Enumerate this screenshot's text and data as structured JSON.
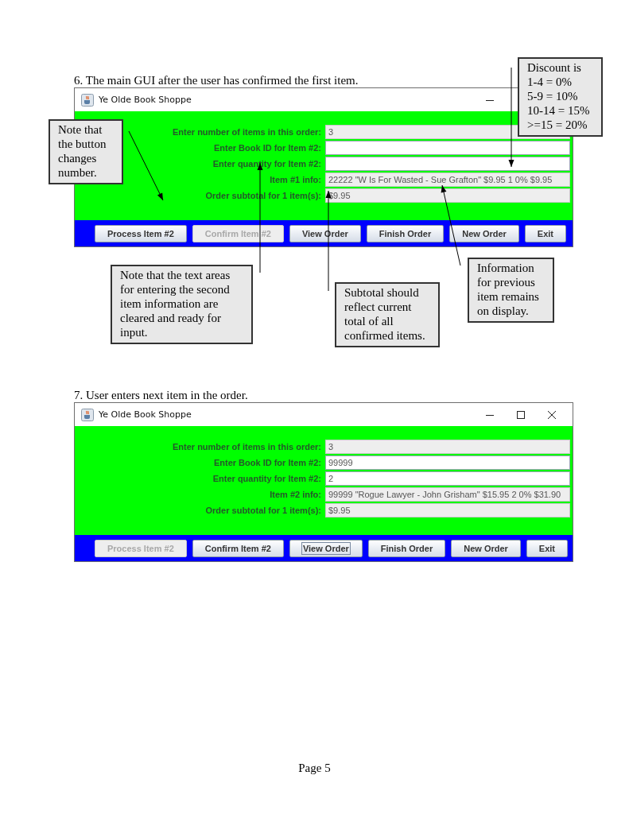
{
  "steps": [
    {
      "caption": "6. The main GUI after the user has confirmed the first item.",
      "window": {
        "title": "Ye Olde Book Shoppe",
        "controls": [
          {
            "kind": "minimize"
          }
        ],
        "rows": [
          {
            "label": "Enter number of items in this order:",
            "value": "3",
            "editable": false
          },
          {
            "label": "Enter Book ID for Item #2:",
            "value": "",
            "editable": true
          },
          {
            "label": "Enter quantity for Item #2:",
            "value": "",
            "editable": true
          },
          {
            "label": "Item #1 info:",
            "value": "22222 \"W Is For Wasted - Sue Grafton\" $9.95 1 0% $9.95",
            "editable": false
          },
          {
            "label": "Order subtotal for 1 item(s):",
            "value": "$9.95",
            "editable": false
          }
        ],
        "buttons": [
          {
            "label": "Process Item #2",
            "disabled": false,
            "focused": false
          },
          {
            "label": "Confirm Item #2",
            "disabled": true,
            "focused": false
          },
          {
            "label": "View Order",
            "disabled": false,
            "focused": false
          },
          {
            "label": "Finish Order",
            "disabled": false,
            "focused": false
          },
          {
            "label": "New Order",
            "disabled": false,
            "focused": false
          },
          {
            "label": "Exit",
            "disabled": false,
            "focused": false
          }
        ]
      }
    },
    {
      "caption": "7.  User enters next item in the order.",
      "window": {
        "title": "Ye Olde Book Shoppe",
        "controls": [
          {
            "kind": "minimize"
          },
          {
            "kind": "maximize"
          },
          {
            "kind": "close"
          }
        ],
        "rows": [
          {
            "label": "Enter number of items in this order:",
            "value": "3",
            "editable": false
          },
          {
            "label": "Enter Book ID for Item #2:",
            "value": "99999",
            "editable": true
          },
          {
            "label": "Enter quantity for Item #2:",
            "value": "2",
            "editable": true
          },
          {
            "label": "Item #2 info:",
            "value": "99999 \"Rogue Lawyer - John Grisham\" $15.95 2 0% $31.90",
            "editable": false
          },
          {
            "label": "Order subtotal for 1 item(s):",
            "value": "$9.95",
            "editable": false
          }
        ],
        "buttons": [
          {
            "label": "Process Item #2",
            "disabled": true,
            "focused": false
          },
          {
            "label": "Confirm Item #2",
            "disabled": false,
            "focused": false
          },
          {
            "label": "View Order",
            "disabled": false,
            "focused": true
          },
          {
            "label": "Finish Order",
            "disabled": false,
            "focused": false
          },
          {
            "label": "New Order",
            "disabled": false,
            "focused": false
          },
          {
            "label": "Exit",
            "disabled": false,
            "focused": false
          }
        ]
      }
    }
  ],
  "callouts": [
    {
      "lines": [
        "Note that",
        "the button",
        "changes",
        "number."
      ]
    },
    {
      "lines": [
        "Discount is",
        "1-4 = 0%",
        "5-9 = 10%",
        "10-14 = 15%",
        ">=15 = 20%"
      ]
    },
    {
      "lines": [
        "Note that the text areas",
        "for entering the second",
        "item information are",
        "cleared and ready for",
        "input."
      ]
    },
    {
      "lines": [
        "Subtotal should",
        "reflect current",
        "total of all",
        "confirmed items."
      ]
    },
    {
      "lines": [
        "Information",
        "for previous",
        "item remains",
        "on display."
      ]
    }
  ],
  "page_number": "Page 5"
}
